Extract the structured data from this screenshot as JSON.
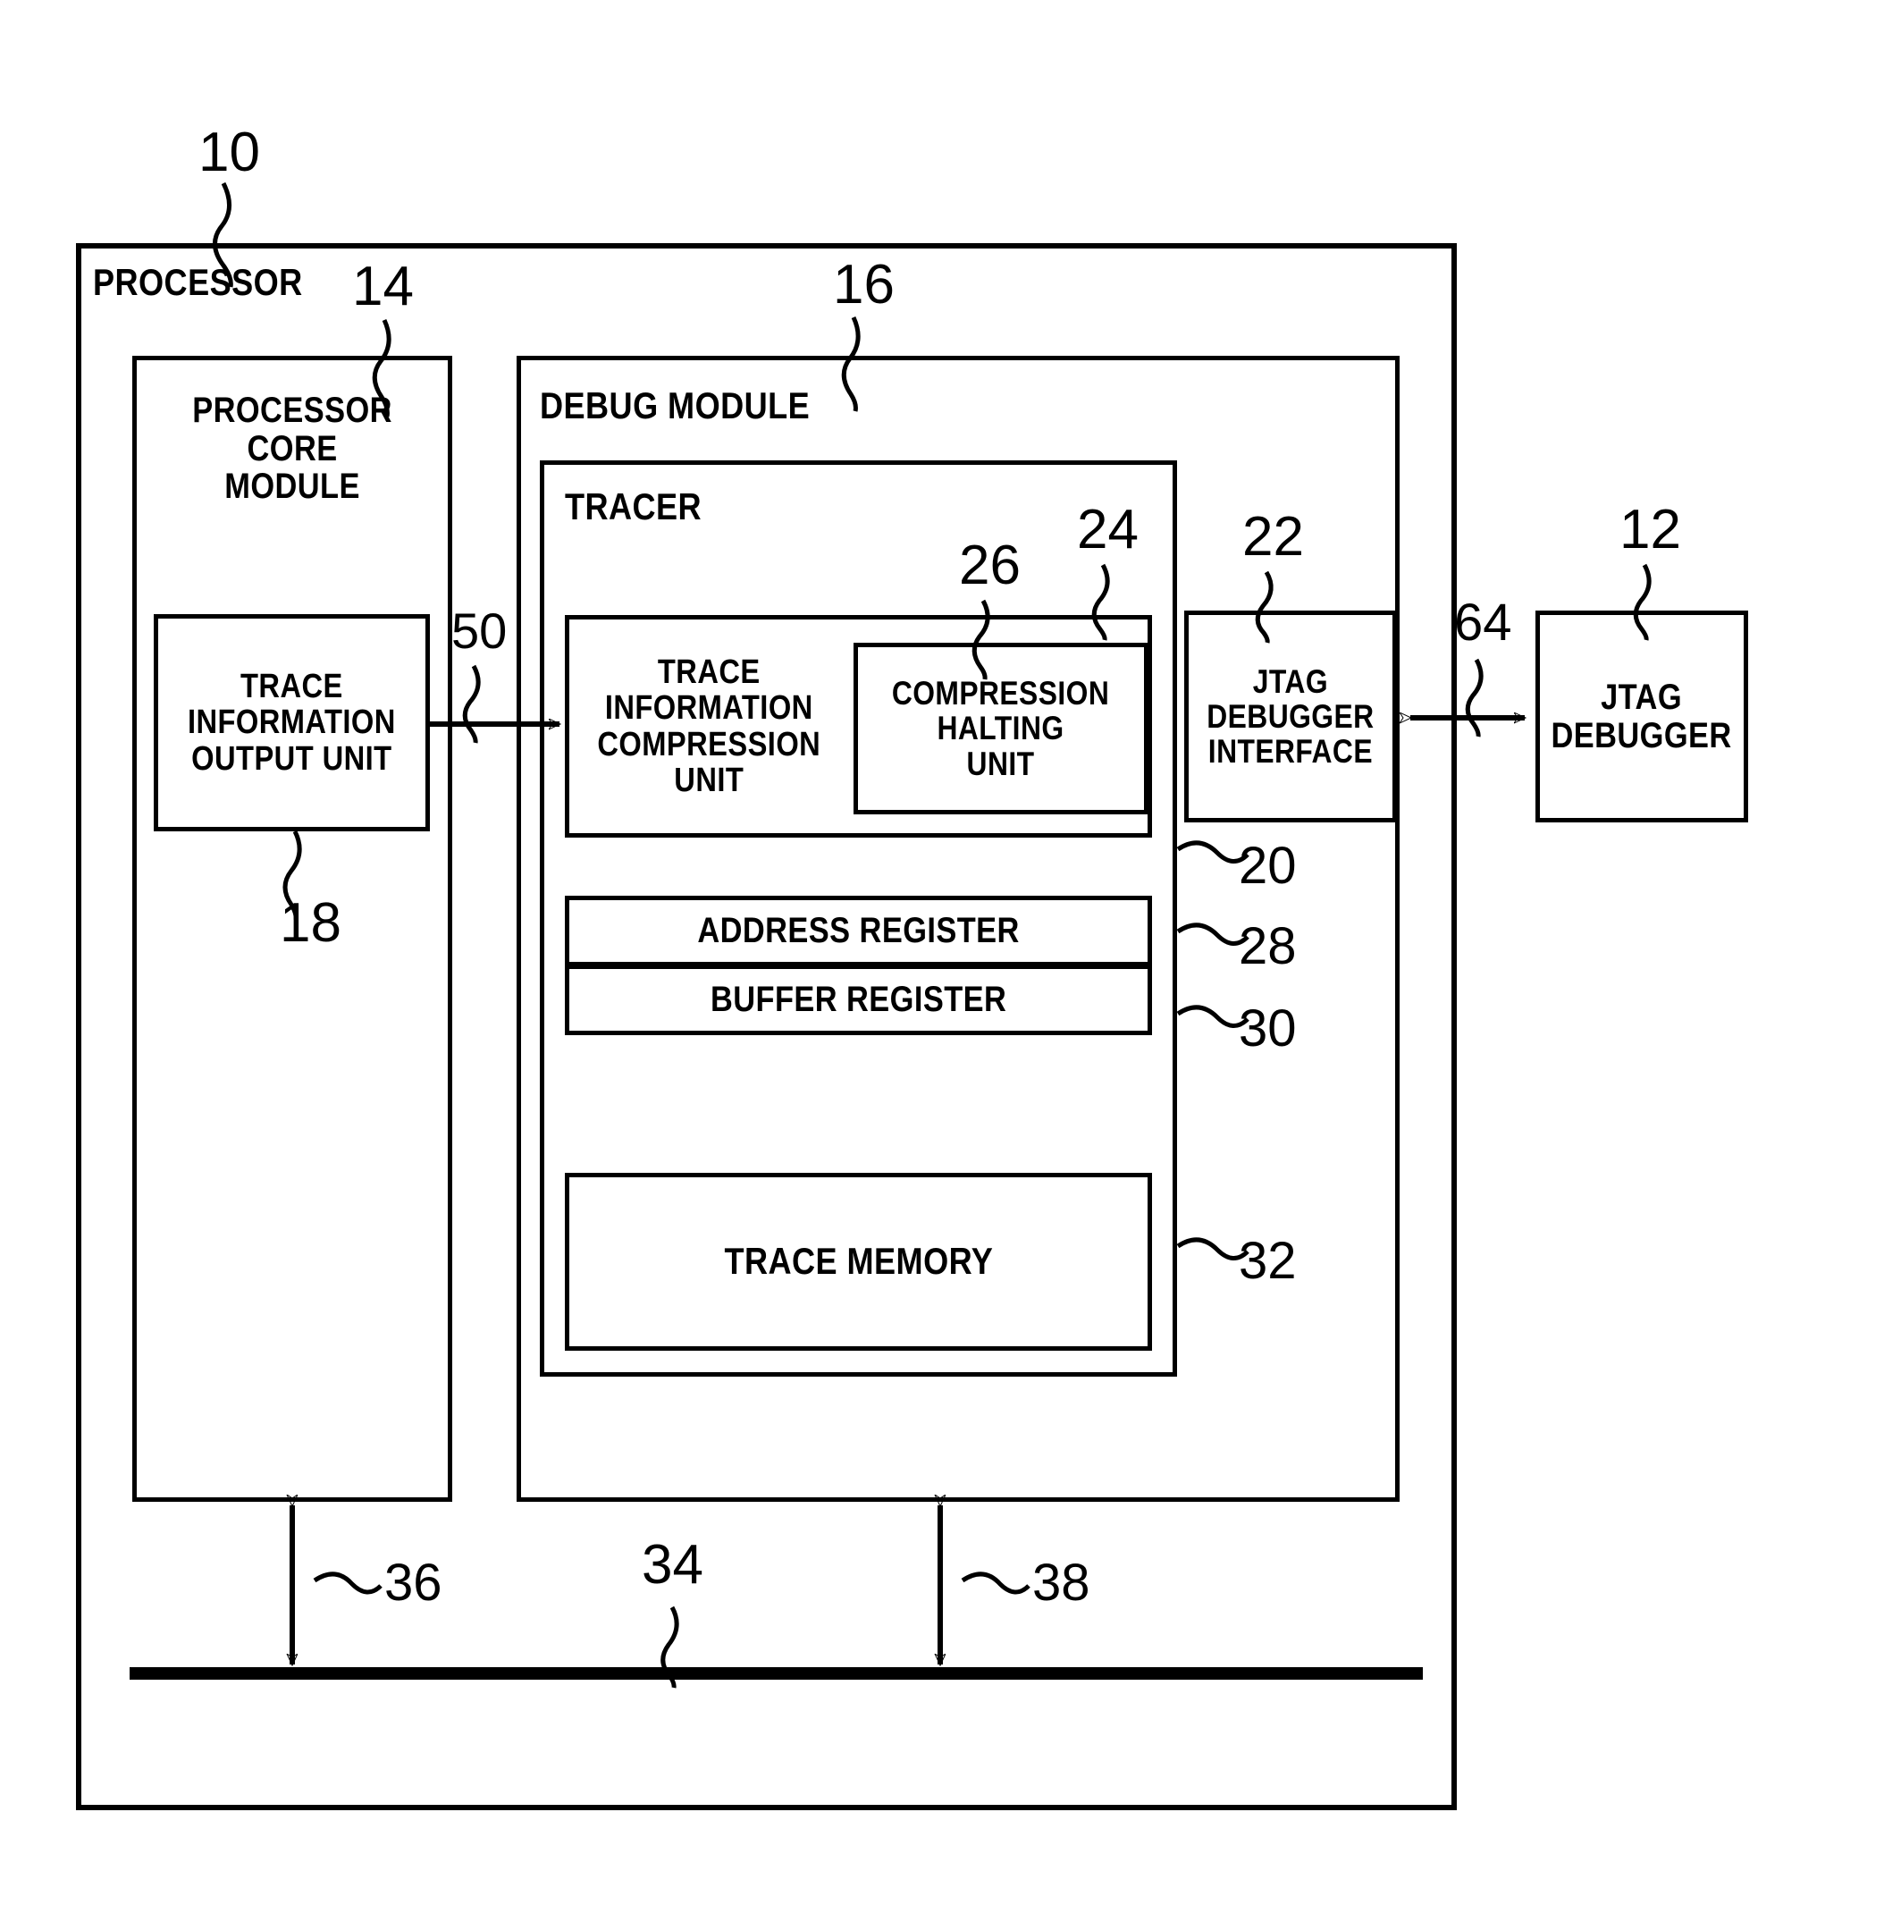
{
  "figure": {
    "type": "patent-block-diagram",
    "background_color": "#ffffff",
    "line_color": "#000000"
  },
  "blocks": {
    "processor": {
      "label": "PROCESSOR",
      "ref": "10"
    },
    "processor_core_module": {
      "label": "PROCESSOR\nCORE\nMODULE",
      "ref": "14"
    },
    "trace_information_output_unit": {
      "label": "TRACE\nINFORMATION\nOUTPUT UNIT",
      "ref": "18"
    },
    "debug_module": {
      "label": "DEBUG MODULE",
      "ref": "16"
    },
    "tracer": {
      "label": "TRACER",
      "ref": "20"
    },
    "trace_information_compression_unit": {
      "label": "TRACE\nINFORMATION\nCOMPRESSION\nUNIT",
      "ref": "24"
    },
    "compression_halting_unit": {
      "label": "COMPRESSION\nHALTING\nUNIT",
      "ref": "26"
    },
    "address_register": {
      "label": "ADDRESS REGISTER",
      "ref": "28"
    },
    "buffer_register": {
      "label": "BUFFER REGISTER",
      "ref": "30"
    },
    "trace_memory": {
      "label": "TRACE MEMORY",
      "ref": "32"
    },
    "jtag_debugger_interface": {
      "label": "JTAG\nDEBUGGER\nINTERFACE",
      "ref": "22"
    },
    "jtag_debugger": {
      "label": "JTAG\nDEBUGGER",
      "ref": "12"
    }
  },
  "connections": {
    "trace_out_to_tracer": {
      "ref": "50",
      "style": "arrow-right"
    },
    "jtag_link": {
      "ref": "64",
      "style": "arrow-bidirectional"
    },
    "core_to_bus": {
      "ref": "36",
      "style": "arrow-bidirectional-vertical"
    },
    "debug_to_bus": {
      "ref": "38",
      "style": "arrow-bidirectional-vertical"
    },
    "bus": {
      "ref": "34",
      "style": "thick-line"
    }
  },
  "reference_numerals": [
    {
      "id": "ref-10",
      "text": "10"
    },
    {
      "id": "ref-12",
      "text": "12"
    },
    {
      "id": "ref-14",
      "text": "14"
    },
    {
      "id": "ref-16",
      "text": "16"
    },
    {
      "id": "ref-18",
      "text": "18"
    },
    {
      "id": "ref-20",
      "text": "20"
    },
    {
      "id": "ref-22",
      "text": "22"
    },
    {
      "id": "ref-24",
      "text": "24"
    },
    {
      "id": "ref-26",
      "text": "26"
    },
    {
      "id": "ref-28",
      "text": "28"
    },
    {
      "id": "ref-30",
      "text": "30"
    },
    {
      "id": "ref-32",
      "text": "32"
    },
    {
      "id": "ref-34",
      "text": "34"
    },
    {
      "id": "ref-36",
      "text": "36"
    },
    {
      "id": "ref-38",
      "text": "38"
    },
    {
      "id": "ref-50",
      "text": "50"
    },
    {
      "id": "ref-64",
      "text": "64"
    }
  ]
}
